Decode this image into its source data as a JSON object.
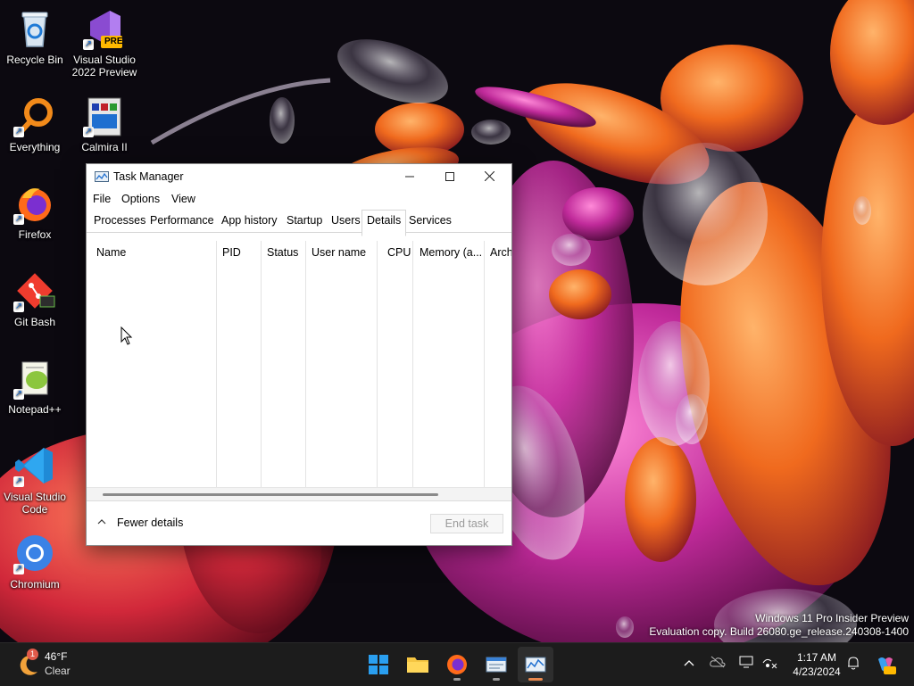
{
  "desktop": {
    "icons": [
      {
        "label": "Recycle Bin"
      },
      {
        "label": "Visual Studio 2022 Preview",
        "badge": "PRE"
      },
      {
        "label": "Everything"
      },
      {
        "label": "Calmira II"
      },
      {
        "label": "Firefox"
      },
      {
        "label": "Git Bash"
      },
      {
        "label": "Notepad++"
      },
      {
        "label": "Visual Studio Code"
      },
      {
        "label": "Chromium"
      }
    ],
    "watermark": {
      "line1": "Windows 11 Pro Insider Preview",
      "line2": "Evaluation copy. Build 26080.ge_release.240308-1400"
    }
  },
  "window": {
    "title": "Task Manager",
    "menu": [
      "File",
      "Options",
      "View"
    ],
    "tabs": [
      "Processes",
      "Performance",
      "App history",
      "Startup",
      "Users",
      "Details",
      "Services"
    ],
    "active_tab": "Details",
    "columns": [
      "Name",
      "PID",
      "Status",
      "User name",
      "CPU",
      "Memory (a...",
      "Arch"
    ],
    "footer": {
      "fewer_details": "Fewer details",
      "end_task": "End task"
    }
  },
  "taskbar": {
    "weather": {
      "temp": "46°F",
      "condition": "Clear",
      "badge": "1"
    },
    "clock": {
      "time": "1:17 AM",
      "date": "4/23/2024"
    },
    "apps": [
      "start-icon",
      "file-explorer-icon",
      "firefox-icon",
      "notepad-icon",
      "task-manager-icon"
    ],
    "tray": [
      "chevron-up-icon",
      "onedrive-icon",
      "display-icon",
      "network-icon",
      "notification-icon",
      "copilot-icon"
    ]
  },
  "colors": {
    "taskbar": "#1c1c1c",
    "active_indicator": "#e9884e",
    "window_bg": "#ffffff"
  }
}
